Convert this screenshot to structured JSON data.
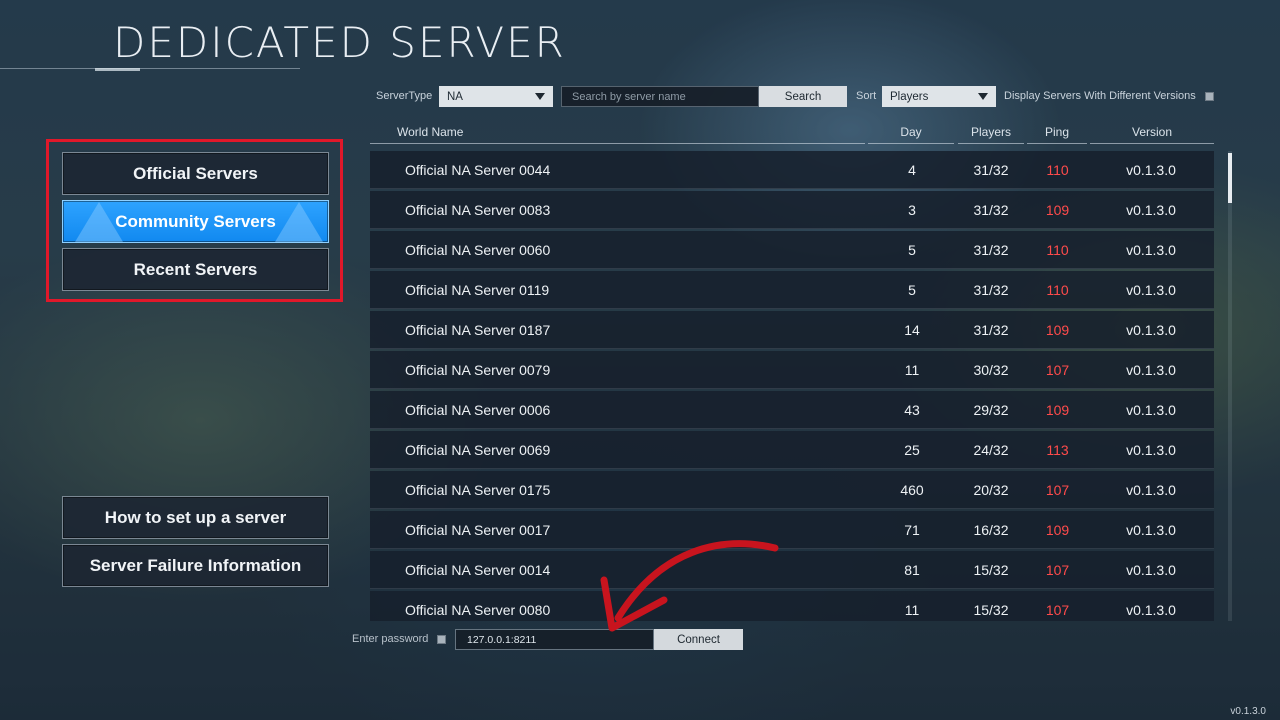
{
  "page_title": "DEDICATED SERVER",
  "menu": {
    "official": "Official Servers",
    "community": "Community Servers",
    "recent": "Recent Servers",
    "help": "How to set up a server",
    "failure": "Server Failure Information"
  },
  "filters": {
    "server_type_label": "ServerType",
    "server_type_value": "NA",
    "search_placeholder": "Search by server name",
    "search_button": "Search",
    "sort_label": "Sort",
    "sort_value": "Players",
    "display_versions_label": "Display Servers With Different Versions"
  },
  "table": {
    "headers": {
      "world_name": "World Name",
      "day": "Day",
      "players": "Players",
      "ping": "Ping",
      "version": "Version"
    },
    "rows": [
      {
        "name": "Official NA Server 0044",
        "day": "4",
        "players": "31/32",
        "ping": "110",
        "version": "v0.1.3.0"
      },
      {
        "name": "Official NA Server 0083",
        "day": "3",
        "players": "31/32",
        "ping": "109",
        "version": "v0.1.3.0"
      },
      {
        "name": "Official NA Server 0060",
        "day": "5",
        "players": "31/32",
        "ping": "110",
        "version": "v0.1.3.0"
      },
      {
        "name": "Official NA Server 0119",
        "day": "5",
        "players": "31/32",
        "ping": "110",
        "version": "v0.1.3.0"
      },
      {
        "name": "Official NA Server 0187",
        "day": "14",
        "players": "31/32",
        "ping": "109",
        "version": "v0.1.3.0"
      },
      {
        "name": "Official NA Server 0079",
        "day": "11",
        "players": "30/32",
        "ping": "107",
        "version": "v0.1.3.0"
      },
      {
        "name": "Official NA Server 0006",
        "day": "43",
        "players": "29/32",
        "ping": "109",
        "version": "v0.1.3.0"
      },
      {
        "name": "Official NA Server 0069",
        "day": "25",
        "players": "24/32",
        "ping": "113",
        "version": "v0.1.3.0"
      },
      {
        "name": "Official NA Server 0175",
        "day": "460",
        "players": "20/32",
        "ping": "107",
        "version": "v0.1.3.0"
      },
      {
        "name": "Official NA Server 0017",
        "day": "71",
        "players": "16/32",
        "ping": "109",
        "version": "v0.1.3.0"
      },
      {
        "name": "Official NA Server 0014",
        "day": "81",
        "players": "15/32",
        "ping": "107",
        "version": "v0.1.3.0"
      },
      {
        "name": "Official NA Server 0080",
        "day": "11",
        "players": "15/32",
        "ping": "107",
        "version": "v0.1.3.0"
      }
    ]
  },
  "connect": {
    "password_label": "Enter password",
    "ip_value": "127.0.0.1:8211",
    "connect_button": "Connect"
  },
  "footer_version": "v0.1.3.0",
  "colors": {
    "highlight_box": "#e0182a",
    "active_tab": "#1189f0",
    "ping_text": "#ff4b4b",
    "annotation_arrow": "#c8141e"
  },
  "icons": [
    "caret-down-icon",
    "checkbox-icon",
    "annotation-arrow-icon"
  ]
}
